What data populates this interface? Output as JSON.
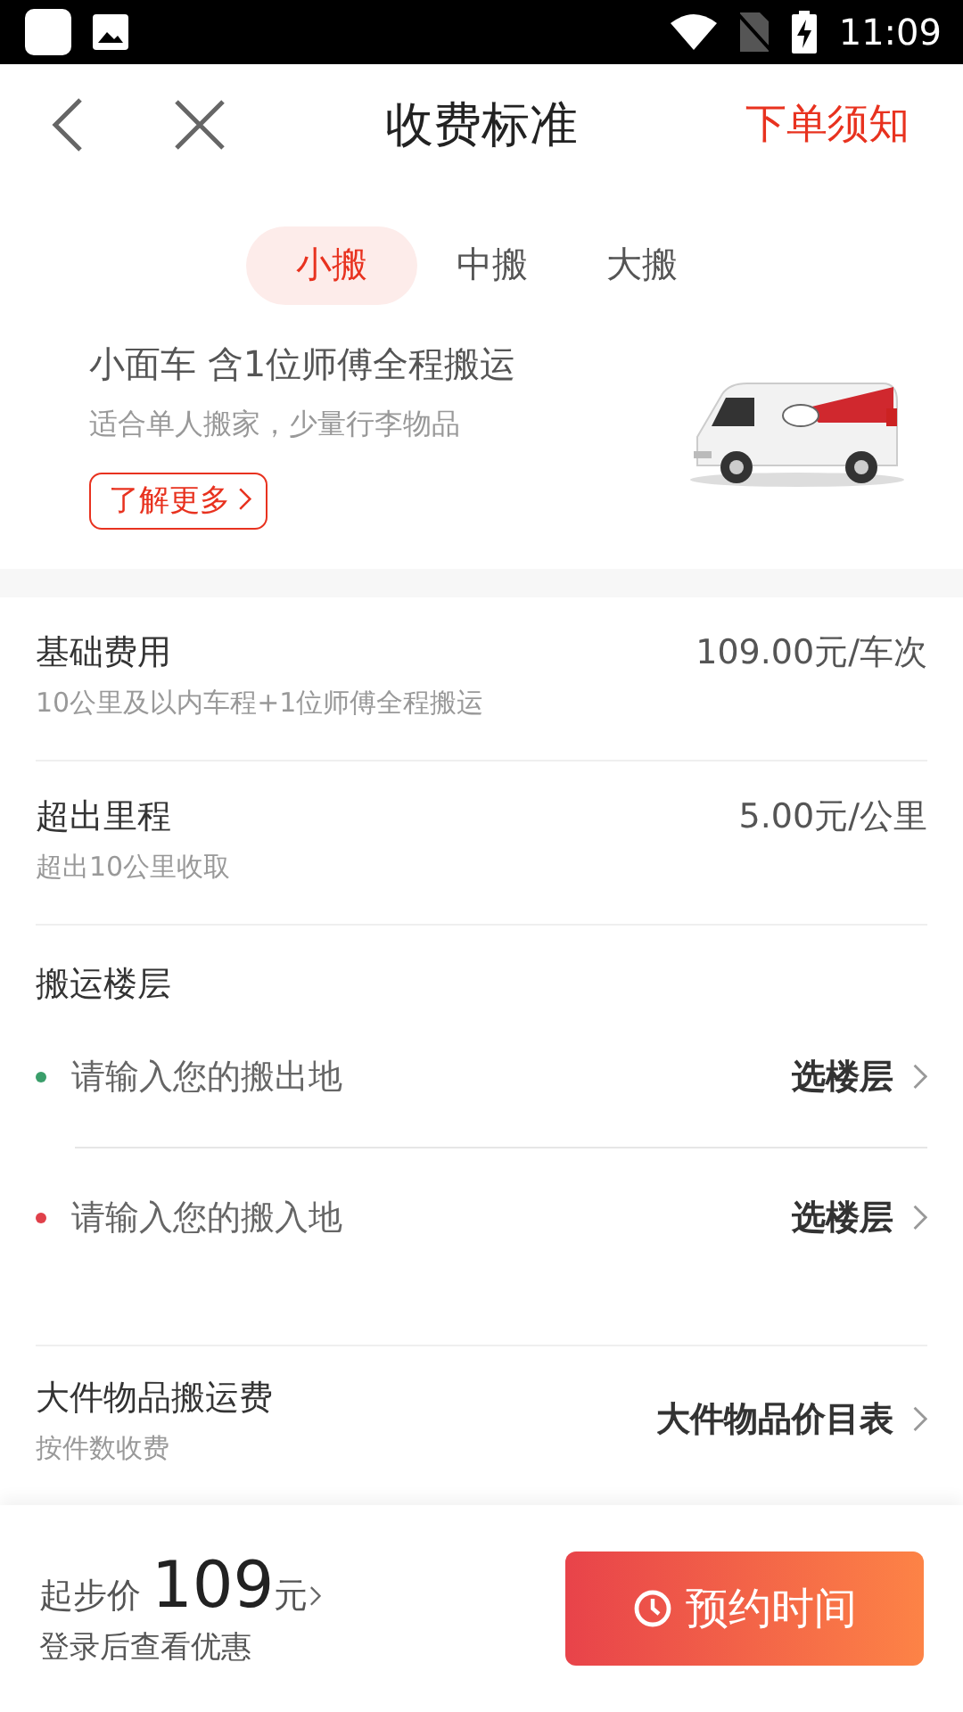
{
  "status_bar": {
    "time": "11:09"
  },
  "header": {
    "title": "收费标准",
    "action": "下单须知"
  },
  "tabs": [
    {
      "label": "小搬",
      "selected": true
    },
    {
      "label": "中搬",
      "selected": false
    },
    {
      "label": "大搬",
      "selected": false
    }
  ],
  "vehicle": {
    "title": "小面车 含1位师傅全程搬运",
    "subtitle": "适合单人搬家，少量行李物品",
    "more_button": "了解更多"
  },
  "fees": [
    {
      "kind": "price",
      "name": "基础费用",
      "description": "10公里及以内车程+1位师傅全程搬运",
      "value": "109.00元/车次"
    },
    {
      "kind": "price",
      "name": "超出里程",
      "description": "超出10公里收取",
      "value": "5.00元/公里"
    },
    {
      "kind": "floors",
      "name": "搬运楼层",
      "addresses": [
        {
          "placeholder": "请输入您的搬出地",
          "color": "#3a9e6a",
          "action": "选楼层"
        },
        {
          "placeholder": "请输入您的搬入地",
          "color": "#e0404a",
          "action": "选楼层"
        }
      ]
    },
    {
      "kind": "link",
      "name": "大件物品搬运费",
      "description": "按件数收费",
      "action": "大件物品价目表"
    }
  ],
  "footer": {
    "label": "起步价",
    "price": "109",
    "unit": "元",
    "note": "登录后查看优惠",
    "button": "预约时间"
  }
}
